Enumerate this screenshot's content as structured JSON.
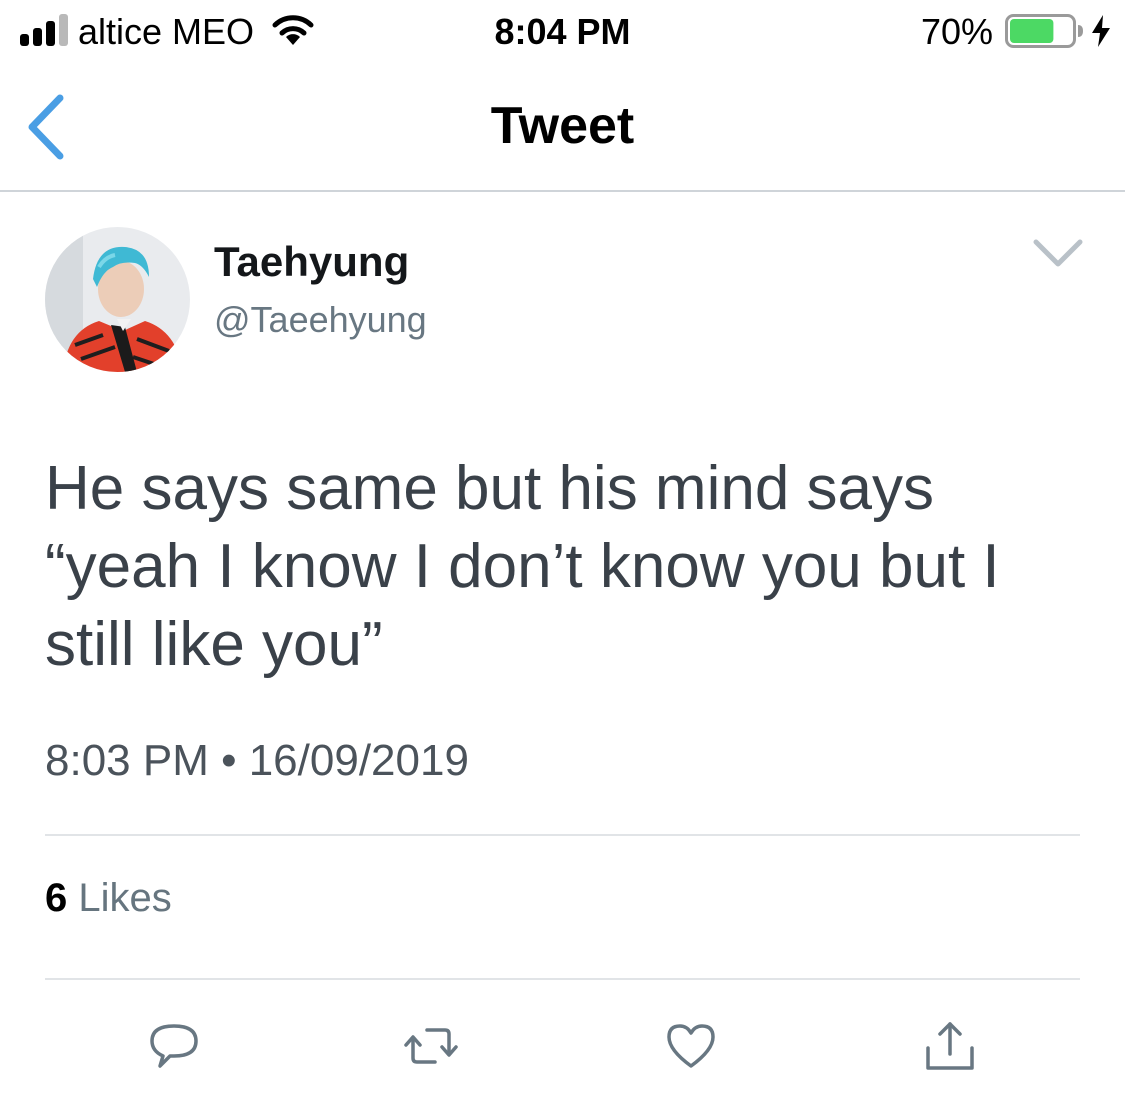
{
  "status_bar": {
    "carrier": "altice MEO",
    "time": "8:04 PM",
    "battery_percent": "70%",
    "battery_level": 0.7,
    "signal_bars_filled": 3,
    "signal_bars_total": 4,
    "battery_color": "#4cd964",
    "icons": [
      "signal-icon",
      "wifi-icon",
      "battery-icon",
      "charging-bolt-icon"
    ]
  },
  "nav": {
    "title": "Tweet",
    "back_icon": "chevron-left-icon",
    "accent_color": "#4a9ee4"
  },
  "tweet": {
    "display_name": "Taehyung",
    "handle": "@Taeehyung",
    "text": "He says same but his mind says “yeah I know I don’t know you but I still like you”",
    "timestamp": "8:03 PM • 16/09/2019",
    "menu_icon": "chevron-down-icon",
    "avatar_icon": "avatar-photo"
  },
  "stats": {
    "likes_count": "6",
    "likes_label": "Likes"
  },
  "actions": {
    "icons": [
      "reply-icon",
      "retweet-icon",
      "like-icon",
      "share-icon"
    ],
    "icon_color": "#687782"
  }
}
